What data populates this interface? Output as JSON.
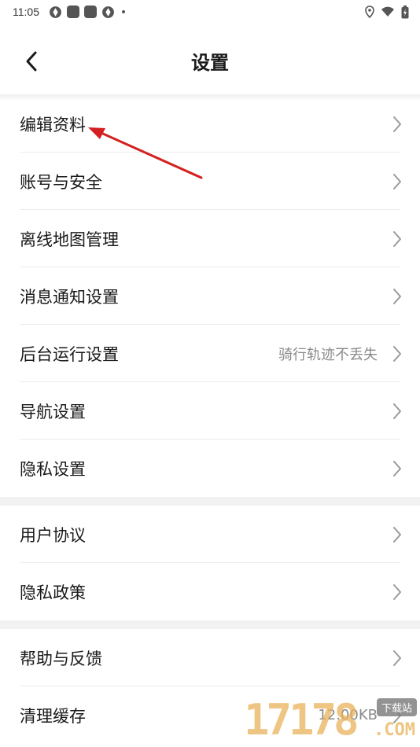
{
  "status_bar": {
    "time": "11:05"
  },
  "header": {
    "title": "设置",
    "back_icon": "chevron-left-icon"
  },
  "groups": [
    {
      "items": [
        {
          "label": "编辑资料",
          "value": ""
        },
        {
          "label": "账号与安全",
          "value": ""
        },
        {
          "label": "离线地图管理",
          "value": ""
        },
        {
          "label": "消息通知设置",
          "value": ""
        },
        {
          "label": "后台运行设置",
          "value": "骑行轨迹不丢失"
        },
        {
          "label": "导航设置",
          "value": ""
        },
        {
          "label": "隐私设置",
          "value": ""
        }
      ]
    },
    {
      "items": [
        {
          "label": "用户协议",
          "value": ""
        },
        {
          "label": "隐私政策",
          "value": ""
        }
      ]
    },
    {
      "items": [
        {
          "label": "帮助与反馈",
          "value": ""
        },
        {
          "label": "清理缓存",
          "value": "12.00KB"
        }
      ]
    }
  ],
  "annotation": {
    "arrow_color": "#d42020"
  },
  "watermark": {
    "digits": "17178",
    "badge": "下载站",
    "suffix": ".COM"
  },
  "colors": {
    "text": "#1a1a1a",
    "secondary_text": "#8a8a8a",
    "section_gap": "#f2f2f2",
    "divider": "#ececec"
  }
}
